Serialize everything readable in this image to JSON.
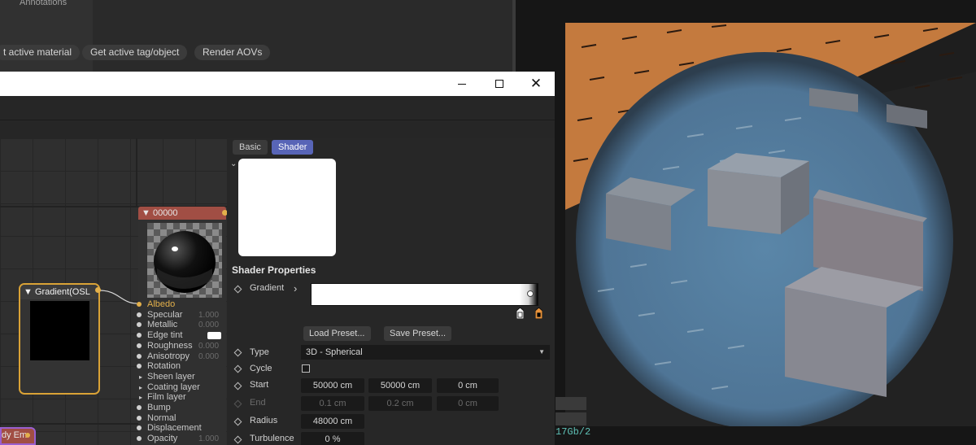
{
  "background": {
    "side_panel_label": "Annotations",
    "status_text": "17Gb/2"
  },
  "window": {
    "controls": {
      "minimize": "minimize",
      "maximize": "maximize",
      "close": "✕"
    }
  },
  "toolbar": {
    "buttons": [
      "t active material",
      "Get active tag/object",
      "Render AOVs"
    ]
  },
  "graph": {
    "gradient_node_title": "Gradient(OSL",
    "material_node_title": "00000",
    "emission_node_title": "dy Em",
    "material_rows": [
      {
        "label": "Albedo",
        "value": "",
        "kind": "dot-accent"
      },
      {
        "label": "Specular",
        "value": "1.000",
        "kind": "dot"
      },
      {
        "label": "Metallic",
        "value": "0.000",
        "kind": "dot"
      },
      {
        "label": "Edge tint",
        "value": "",
        "kind": "dot-swatch"
      },
      {
        "label": "Roughness",
        "value": "0.000",
        "kind": "dot"
      },
      {
        "label": "Anisotropy",
        "value": "0.000",
        "kind": "dot"
      },
      {
        "label": "Rotation",
        "value": "",
        "kind": "dot"
      },
      {
        "label": "Sheen layer",
        "value": "",
        "kind": "tri"
      },
      {
        "label": "Coating layer",
        "value": "",
        "kind": "tri"
      },
      {
        "label": "Film layer",
        "value": "",
        "kind": "tri"
      },
      {
        "label": "Bump",
        "value": "",
        "kind": "dot"
      },
      {
        "label": "Normal",
        "value": "",
        "kind": "dot"
      },
      {
        "label": "Displacement",
        "value": "",
        "kind": "dot"
      },
      {
        "label": "Opacity",
        "value": "1.000",
        "kind": "dot"
      }
    ]
  },
  "props": {
    "tabs": [
      {
        "label": "Basic",
        "active": false
      },
      {
        "label": "Shader",
        "active": true
      }
    ],
    "section_title": "Shader Properties",
    "gradient_label": "Gradient",
    "gradient_expand": "›",
    "load_preset": "Load Preset...",
    "save_preset": "Save Preset...",
    "type_label": "Type",
    "type_value": "3D - Spherical",
    "cycle_label": "Cycle",
    "cycle_checked": false,
    "start_label": "Start",
    "start_values": [
      "50000 cm",
      "50000 cm",
      "0 cm"
    ],
    "end_label": "End",
    "end_values": [
      "0.1 cm",
      "0.2 cm",
      "0 cm"
    ],
    "radius_label": "Radius",
    "radius_value": "48000 cm",
    "turbulence_label": "Turbulence",
    "turbulence_value": "0 %"
  },
  "colors": {
    "accent_tab": "#5865b7",
    "node_selected": "#d9a236",
    "node_header": "#a14e44",
    "albedo_text": "#e3b04b",
    "stop_orange": "#e8923a",
    "status_teal": "#5fc1b6"
  }
}
